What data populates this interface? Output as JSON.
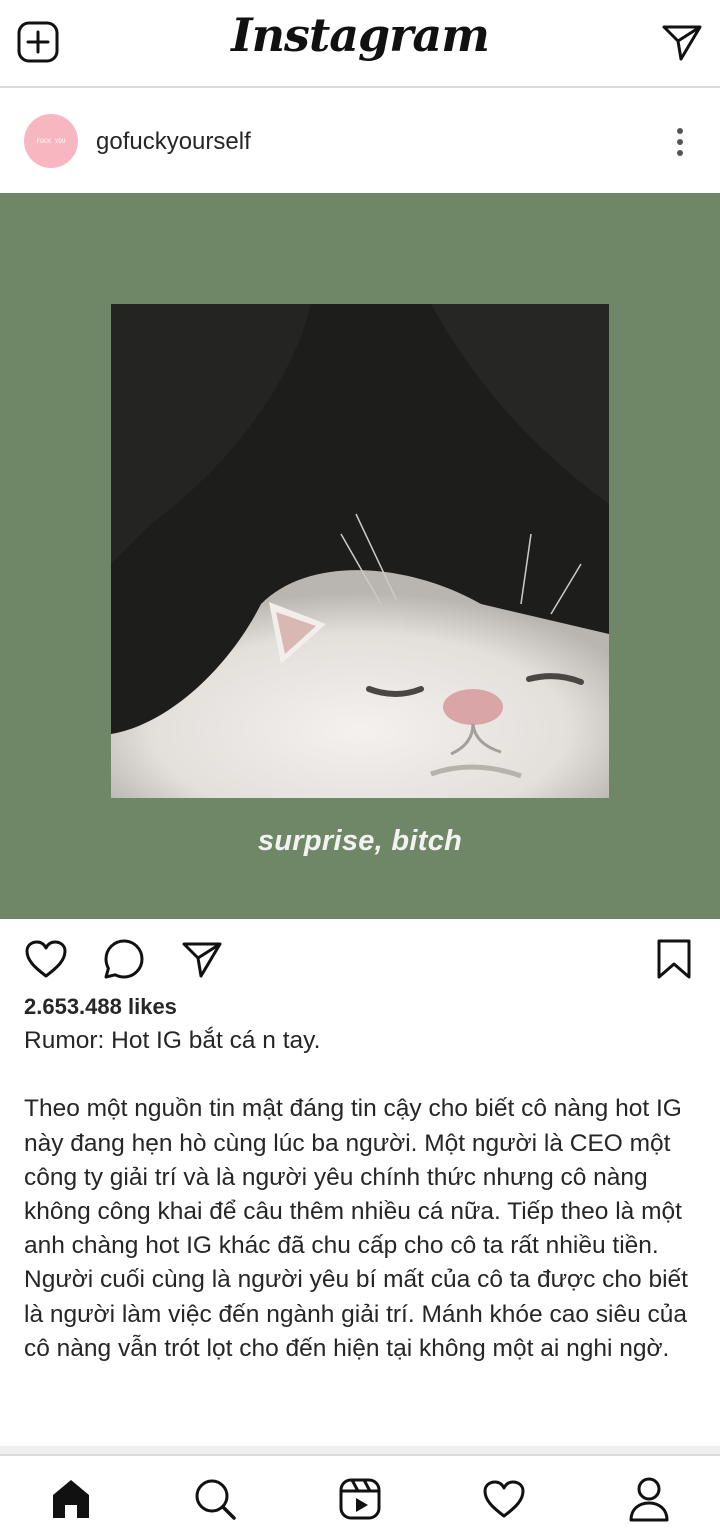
{
  "app": {
    "logo_text": "Instagram"
  },
  "topbar": {
    "new_post_icon": "plus-square-icon",
    "direct_icon": "paper-plane-icon"
  },
  "post": {
    "username": "gofuckyourself",
    "avatar_icon": "profile-avatar",
    "avatar_text": "FUCK YOU",
    "more_icon": "more-vertical-icon",
    "image_overlay_text": "surprise, bitch",
    "likes_text": "2.653.488 likes",
    "caption": "Rumor: Hot IG bắt cá n tay.\n\nTheo một nguồn tin mật đáng tin cậy cho biết cô nàng hot IG này đang hẹn hò cùng lúc ba người. Một người là CEO một công ty giải trí và là người yêu chính thức nhưng cô nàng không công khai để câu thêm nhiều cá nữa. Tiếp theo là một anh chàng hot IG khác đã chu cấp cho cô ta rất nhiều tiền. Người cuối cùng là người yêu bí mất của cô ta được cho biết là người làm việc đến ngành giải trí. Mánh khóe cao siêu của cô nàng vẫn trót lọt cho đến hiện tại không một ai nghi ngờ."
  },
  "actions": {
    "like_icon": "heart-icon",
    "comment_icon": "comment-icon",
    "share_icon": "paper-plane-icon",
    "save_icon": "bookmark-icon"
  },
  "bottom_nav": {
    "items": [
      "home-icon",
      "search-icon",
      "reels-icon",
      "activity-heart-icon",
      "profile-icon"
    ]
  },
  "colors": {
    "image_background": "#6f8766",
    "text": "#262626",
    "divider": "#dbdbdb"
  }
}
